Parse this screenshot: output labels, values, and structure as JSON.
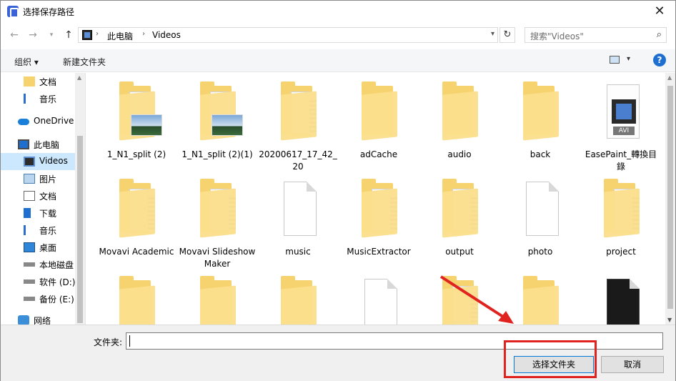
{
  "window": {
    "title": "选择保存路径"
  },
  "address": {
    "segments": [
      "此电脑",
      "Videos"
    ]
  },
  "search": {
    "placeholder": "搜索\"Videos\""
  },
  "toolbar": {
    "organize": "组织 ▾",
    "new_folder": "新建文件夹",
    "help": "?"
  },
  "sidebar": {
    "items": [
      {
        "label": "文档",
        "icon": "folder-icon"
      },
      {
        "label": "音乐",
        "icon": "music-icon"
      },
      {
        "label": "OneDrive",
        "icon": "cloud-icon"
      },
      {
        "label": "此电脑",
        "icon": "computer-icon"
      },
      {
        "label": "Videos",
        "icon": "video-icon",
        "selected": true
      },
      {
        "label": "图片",
        "icon": "pictures-icon"
      },
      {
        "label": "文档",
        "icon": "documents-icon"
      },
      {
        "label": "下载",
        "icon": "download-icon"
      },
      {
        "label": "音乐",
        "icon": "music-icon"
      },
      {
        "label": "桌面",
        "icon": "desktop-icon"
      },
      {
        "label": "本地磁盘",
        "icon": "drive-icon"
      },
      {
        "label": "软件 (D:)",
        "icon": "drive-icon"
      },
      {
        "label": "备份 (E:)",
        "icon": "drive-icon"
      },
      {
        "label": "网络",
        "icon": "network-icon"
      }
    ]
  },
  "files": [
    {
      "name": "1_N1_split (2)",
      "kind": "folder-image"
    },
    {
      "name": "1_N1_split (2)(1)",
      "kind": "folder-image"
    },
    {
      "name": "20200617_17_42_20",
      "kind": "folder-doc"
    },
    {
      "name": "adCache",
      "kind": "folder"
    },
    {
      "name": "audio",
      "kind": "folder"
    },
    {
      "name": "back",
      "kind": "folder"
    },
    {
      "name": "EasePaint_轉換目錄",
      "kind": "avi"
    },
    {
      "name": "Movavi Academic",
      "kind": "folder-doc"
    },
    {
      "name": "Movavi Slideshow Maker",
      "kind": "folder-doc"
    },
    {
      "name": "music",
      "kind": "doc"
    },
    {
      "name": "MusicExtractor",
      "kind": "folder-doc"
    },
    {
      "name": "output",
      "kind": "folder-doc"
    },
    {
      "name": "photo",
      "kind": "doc"
    },
    {
      "name": "project",
      "kind": "folder-doc"
    },
    {
      "name": "",
      "kind": "folder"
    },
    {
      "name": "",
      "kind": "folder"
    },
    {
      "name": "",
      "kind": "folder"
    },
    {
      "name": "",
      "kind": "doc"
    },
    {
      "name": "",
      "kind": "folder-doc"
    },
    {
      "name": "",
      "kind": "folder"
    },
    {
      "name": "",
      "kind": "dark"
    }
  ],
  "bottom": {
    "folder_label": "文件夹:",
    "folder_value": "",
    "select_button": "选择文件夹",
    "cancel_button": "取消"
  },
  "colors": {
    "accent": "#0078d7",
    "highlight": "#e0231f",
    "selected": "#cce8ff"
  }
}
